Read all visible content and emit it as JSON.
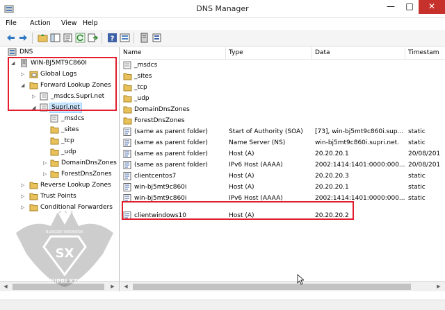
{
  "window": {
    "title": "DNS Manager",
    "minimize_glyph": "—",
    "maximize_glyph": "□",
    "close_glyph": "✕"
  },
  "menu": [
    "File",
    "Action",
    "View",
    "Help"
  ],
  "toolbar_icons": [
    "back-arrow-icon",
    "forward-arrow-icon",
    "up-folder-icon",
    "show-hide-tree-icon",
    "properties-icon",
    "refresh-icon",
    "export-list-icon",
    "help-icon",
    "details-view-icon",
    "server-icon",
    "record-icon"
  ],
  "tree": {
    "root": "DNS",
    "server": "WIN-BJ5MT9C860I",
    "global_logs": "Global Logs",
    "forward_zones": "Forward Lookup Zones",
    "msdcs_zone": "_msdcs.Supri.net",
    "supri_zone": "Supri.net",
    "sub_items": [
      "_msdcs",
      "_sites",
      "_tcp",
      "_udp",
      "DomainDnsZones",
      "ForestDnsZones"
    ],
    "reverse_zones": "Reverse Lookup Zones",
    "trust_points": "Trust Points",
    "conditional_forwarders": "Conditional Forwarders"
  },
  "columns": [
    "Name",
    "Type",
    "Data",
    "Timestam"
  ],
  "records": [
    {
      "name": "_msdcs",
      "type": "",
      "data": "",
      "timestamp": "",
      "kind": "folder-dim"
    },
    {
      "name": "_sites",
      "type": "",
      "data": "",
      "timestamp": "",
      "kind": "folder"
    },
    {
      "name": "_tcp",
      "type": "",
      "data": "",
      "timestamp": "",
      "kind": "folder"
    },
    {
      "name": "_udp",
      "type": "",
      "data": "",
      "timestamp": "",
      "kind": "folder"
    },
    {
      "name": "DomainDnsZones",
      "type": "",
      "data": "",
      "timestamp": "",
      "kind": "folder"
    },
    {
      "name": "ForestDnsZones",
      "type": "",
      "data": "",
      "timestamp": "",
      "kind": "folder"
    },
    {
      "name": "(same as parent folder)",
      "type": "Start of Authority (SOA)",
      "data": "[73], win-bj5mt9c860i.sup...",
      "timestamp": "static",
      "kind": "record"
    },
    {
      "name": "(same as parent folder)",
      "type": "Name Server (NS)",
      "data": "win-bj5mt9c860i.supri.net.",
      "timestamp": "static",
      "kind": "record"
    },
    {
      "name": "(same as parent folder)",
      "type": "Host (A)",
      "data": "20.20.20.1",
      "timestamp": "20/08/201",
      "kind": "record"
    },
    {
      "name": "(same as parent folder)",
      "type": "IPv6 Host (AAAA)",
      "data": "2002:1414:1401:0000:000...",
      "timestamp": "20/08/201",
      "kind": "record"
    },
    {
      "name": "clientcentos7",
      "type": "Host (A)",
      "data": "20.20.20.3",
      "timestamp": "static",
      "kind": "record"
    },
    {
      "name": "win-bj5mt9c860i",
      "type": "Host (A)",
      "data": "20.20.20.1",
      "timestamp": "static",
      "kind": "record"
    },
    {
      "name": "win-bj5mt9c860i",
      "type": "IPv6 Host (AAAA)",
      "data": "2002:1414:1401:0000:000...",
      "timestamp": "static",
      "kind": "record"
    },
    {
      "name": "clientwindows10",
      "type": "Host (A)",
      "data": "20.20.20.2",
      "timestamp": "",
      "kind": "record"
    }
  ],
  "watermark": {
    "top_text": "BLOGGER INDONESIA",
    "letter": "SX",
    "bottom_text": "SUPRI XZZ"
  },
  "colors": {
    "highlight_red": "#e21d2d",
    "selection": "#cce8ff",
    "folder_yellow": "#e8c15a",
    "close_red": "#c7312b"
  }
}
